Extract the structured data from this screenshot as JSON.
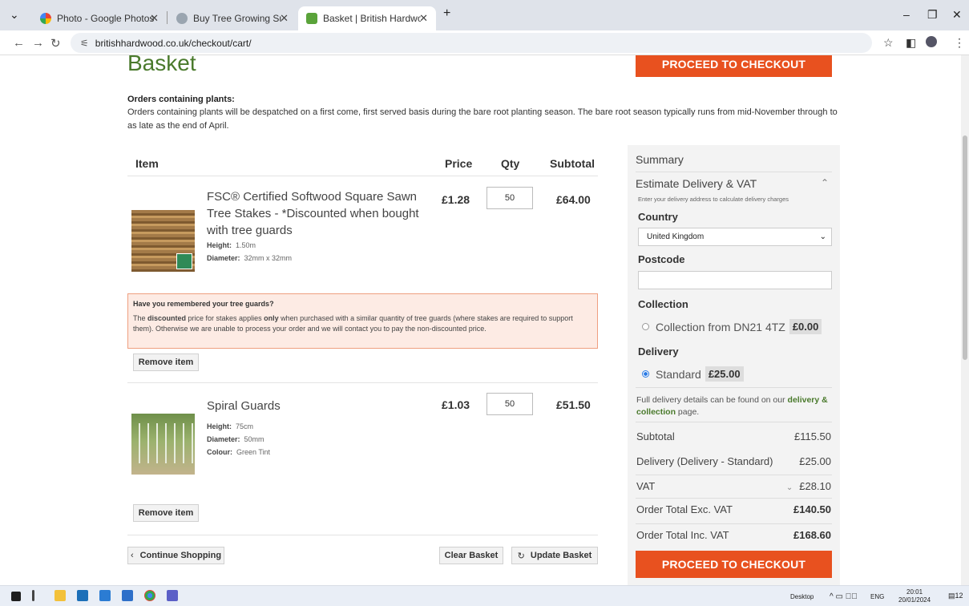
{
  "browser": {
    "tabs": [
      {
        "title": "Photo - Google Photos",
        "color": "#f4b400"
      },
      {
        "title": "Buy Tree Growing Supplies Onl",
        "color": "#7a8a99"
      },
      {
        "title": "Basket | British Hardwood Tree",
        "color": "#5aa33a"
      }
    ],
    "new_tab": "+",
    "url": "britishhardwood.co.uk/checkout/cart/"
  },
  "page": {
    "title": "Basket",
    "checkout_label": "PROCEED TO CHECKOUT",
    "notice_heading": "Orders containing plants:",
    "notice_body": "Orders containing plants will be despatched on a first come, first served basis during the bare root planting season. The bare root season typically runs from mid-November through to as late as the end of April.",
    "columns": {
      "item": "Item",
      "price": "Price",
      "qty": "Qty",
      "subtotal": "Subtotal"
    },
    "items": [
      {
        "name": "FSC® Certified Softwood Square Sawn Tree Stakes - *Discounted when bought with tree guards",
        "attrs": [
          {
            "k": "Height:",
            "v": "1.50m"
          },
          {
            "k": "Diameter:",
            "v": "32mm x 32mm"
          }
        ],
        "price": "£1.28",
        "qty": "50",
        "subtotal": "£64.00",
        "remove": "Remove item"
      },
      {
        "name": "Spiral Guards",
        "attrs": [
          {
            "k": "Height:",
            "v": "75cm"
          },
          {
            "k": "Diameter:",
            "v": "50mm"
          },
          {
            "k": "Colour:",
            "v": "Green Tint"
          }
        ],
        "price": "£1.03",
        "qty": "50",
        "subtotal": "£51.50",
        "remove": "Remove item"
      }
    ],
    "warning": {
      "heading": "Have you remembered your tree guards?",
      "pre": "The ",
      "bold1": "discounted",
      "mid": " price for stakes applies ",
      "bold2": "only",
      "post": " when purchased with a similar quantity of tree guards (where stakes are required to support them). Otherwise we are unable to process your order and we will contact you to pay the non-discounted price."
    },
    "actions": {
      "continue": "Continue Shopping",
      "clear": "Clear Basket",
      "update": "Update Basket"
    }
  },
  "summary": {
    "title": "Summary",
    "estimate": "Estimate Delivery & VAT",
    "estimate_hint": "Enter your delivery address to calculate delivery charges",
    "country_label": "Country",
    "country_value": "United Kingdom",
    "postcode_label": "Postcode",
    "postcode_value": "",
    "collection_label": "Collection",
    "collection_option": "Collection from DN21 4TZ",
    "collection_price": "£0.00",
    "delivery_label": "Delivery",
    "delivery_option": "Standard",
    "delivery_price": "£25.00",
    "info_pre": "Full delivery details can be found on our ",
    "info_link": "delivery & collection",
    "info_post": " page.",
    "rows": [
      {
        "label": "Subtotal",
        "value": "£115.50"
      },
      {
        "label": "Delivery (Delivery - Standard)",
        "value": "£25.00"
      },
      {
        "label": "VAT",
        "value": "£28.10"
      },
      {
        "label": "Order Total Exc. VAT",
        "value": "£140.50"
      },
      {
        "label": "Order Total Inc. VAT",
        "value": "£168.60"
      }
    ]
  },
  "taskbar": {
    "desktop": "Desktop",
    "lang": "ENG",
    "time": "20:01",
    "date": "20/01/2024",
    "badge": "12"
  },
  "colors": {
    "accent": "#e8511f",
    "brand": "#4a7a2c"
  }
}
